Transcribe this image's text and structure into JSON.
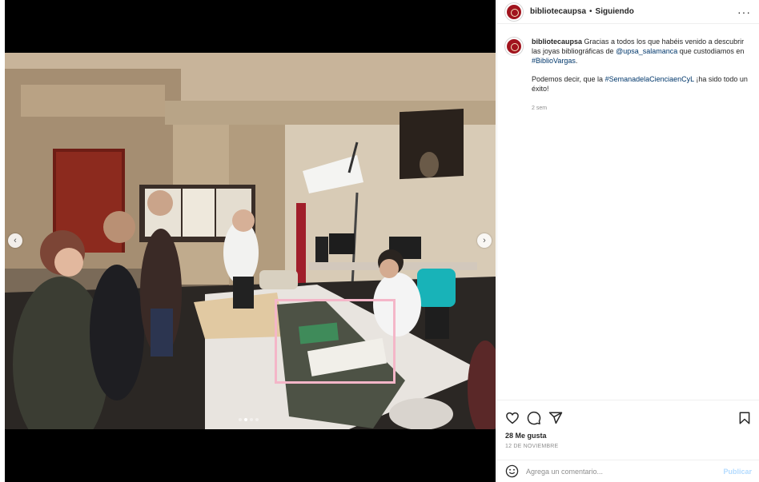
{
  "post": {
    "username": "bibliotecaupsa",
    "separator": "•",
    "follow_status": "Siguiendo",
    "more": "···"
  },
  "caption": {
    "username": "bibliotecaupsa",
    "text_1": "Gracias a todos los que habéis venido a descubrir las joyas bibliográficas de",
    "mention": "@upsa_salamanca",
    "text_2": "que custodiamos en",
    "hashtag_1": "#BiblioVargas",
    "text_3": ".",
    "para2_text_1": "Podemos decir, que la",
    "hashtag_2": "#SemanadelaCienciaenCyL",
    "para2_text_2": "¡ha sido todo un éxito!",
    "time": "2 sem"
  },
  "carousel": {
    "prev": "‹",
    "next": "›",
    "slide_count": 4,
    "active_slide": 2,
    "highlight_color": "#f4b6c8"
  },
  "actions": {
    "likes": "28 Me gusta",
    "date": "12 DE NOVIEMBRE"
  },
  "comment": {
    "placeholder": "Agrega un comentario...",
    "publish": "Publicar"
  },
  "colors": {
    "brand": "#a1141e",
    "link": "#00376b",
    "publish_disabled": "#b3dbff"
  },
  "icons": [
    "like-icon",
    "comment-icon",
    "share-icon",
    "save-icon",
    "emoji-icon"
  ]
}
